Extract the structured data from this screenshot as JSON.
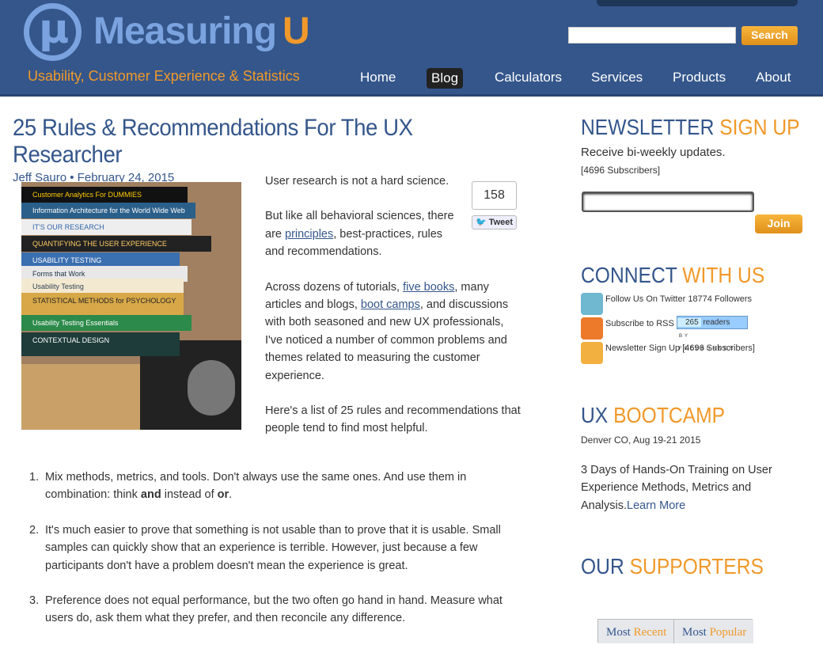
{
  "header": {
    "logo_main": "Measuring",
    "logo_accent": "U",
    "logo_symbol": "μ",
    "tagline": "Usability, Customer Experience & Statistics",
    "search_placeholder": "",
    "search_button": "Search",
    "nav": [
      {
        "label": "Home"
      },
      {
        "label": "Blog",
        "active": true
      },
      {
        "label": "Calculators"
      },
      {
        "label": "Services"
      },
      {
        "label": "Products"
      },
      {
        "label": "About"
      }
    ]
  },
  "article": {
    "title": "25 Rules & Recommendations For The UX Researcher",
    "byline": "Jeff Sauro • February 24, 2015",
    "photo_book_titles": [
      "Customer Analytics For DUMMIES",
      "Information Architecture for the World Wide Web",
      "IT'S OUR RESEARCH",
      "QUANTIFYING THE USER EXPERIENCE",
      "USABILITY TESTING",
      "Forms that Work",
      "Usability Testing",
      "STATISTICAL METHODS for PSYCHOLOGY",
      "Usability Testing Essentials",
      "CONTEXTUAL DESIGN"
    ],
    "share_count": "158",
    "tweet_label": "Tweet",
    "p1": "User research is not a hard science.",
    "p2_a": "But like all behavioral sciences, there are ",
    "p2_link": "principles",
    "p2_b": ", best-practices, rules and recommendations.",
    "p3_a": "Across dozens of tutorials, ",
    "p3_link1": "five books",
    "p3_b": ", many articles and blogs, ",
    "p3_link2": "boot camps",
    "p3_c": ", and discussions with both seasoned and new UX professionals, I've noticed a number of common problems and themes related to measuring the customer experience.",
    "p4": "Here's a list of 25 rules and recommendations that people tend to find most helpful.",
    "rules": [
      {
        "n": "1.",
        "a": "Mix methods, metrics, and tools. Don't always use the same ones. And use them in combination: think ",
        "b1": "and",
        "c": " instead of ",
        "b2": "or",
        "d": "."
      },
      {
        "n": "2.",
        "a": "It's much easier to prove that something is not usable than to prove that it is usable. Small samples can quickly show that an experience is terrible. However, just because a few participants don't have a problem doesn't mean the experience is great."
      },
      {
        "n": "3.",
        "a": "Preference does not equal performance, but the two often go hand in hand. Measure what users do, ask them what they prefer, and then reconcile any difference."
      }
    ]
  },
  "sidebar": {
    "newsletter": {
      "h": "NEWSLETTER",
      "h_accent": "SIGN UP",
      "text": "Receive bi-weekly updates.",
      "subs": "[4696 Subscribers]",
      "join": "Join"
    },
    "connect": {
      "h": "CONNECT",
      "h_accent": "WITH US",
      "twitter": "Follow Us On Twitter 18774 Followers",
      "rss": "Subscribe to RSS",
      "readers_count": "265",
      "readers_label": "readers",
      "by": "BY FEEDBURNER",
      "newsletter": "Newsletter Sign Up [4696 Subscribers]"
    },
    "bootcamp": {
      "h": "UX",
      "h_accent": "BOOTCAMP",
      "where": "Denver CO, Aug 19-21 2015",
      "text": "3 Days of Hands-On Training on User Experience Methods, Metrics and Analysis.",
      "link": "Learn More"
    },
    "supporters": {
      "h": "OUR",
      "h_accent": "SUPPORTERS"
    },
    "tabs": [
      {
        "a": "Most",
        "b": "Recent"
      },
      {
        "a": "Most",
        "b": "Popular"
      }
    ]
  },
  "colors": {
    "header": "#34568b",
    "accent": "#f0992a",
    "link": "#34568b"
  }
}
